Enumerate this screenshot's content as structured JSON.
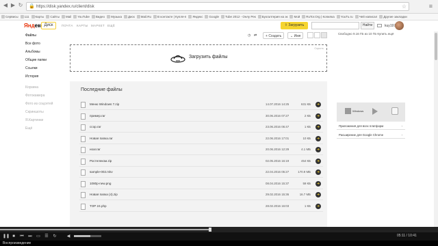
{
  "browser": {
    "url": "https://disk.yandex.ru/client/disk",
    "bookmarks": [
      "Сервисы",
      "111",
      "Карты",
      "Сайты",
      "Mail",
      "YouTube",
      "Видео",
      "Музыка",
      "Диск",
      "Mail.Ru",
      "В контакте | Купля-п",
      "Яндекс",
      "Google",
      "Tube 2012 - Онлу Рек",
      "Бухгалтерия на эк",
      "Мой",
      "RuTor.Org | Копилка",
      "YouTu.ru",
      "Чей написал",
      "Другие закладки"
    ]
  },
  "header": {
    "logo_main": "Янд",
    "logo_accent": "екс",
    "disk_label": "Диск",
    "nav": [
      "ПОЧТА",
      "КАРТЫ",
      "МАРКЕТ",
      "ЕЩЁ"
    ],
    "upload_label": "Загрузить",
    "search_placeholder": "",
    "find_label": "Найти",
    "username": "kuy1975"
  },
  "sidebar": {
    "items": [
      "Файлы",
      "Все фото",
      "Альбомы",
      "Общие папки",
      "Ссылки",
      "История"
    ],
    "extra": [
      "Корзина",
      "Фотокамера",
      "Фото из соцсетей",
      "Скриншоты",
      "Я.Картинки",
      "Ещё"
    ]
  },
  "toolbar": {
    "create_label": "Создать",
    "sort_label": "Имя"
  },
  "dropzone": {
    "label": "Загрузить файлы",
    "hint": "Скрыть"
  },
  "recent": {
    "title": "Последние файлы",
    "files": [
      {
        "name": "Меню Windows 7.zip",
        "date": "14.07.2016 14:25",
        "size": "631 КБ"
      },
      {
        "name": "пример.rar",
        "date": "30.06.2016 07:27",
        "size": "2 КБ"
      },
      {
        "name": "ccop.rar",
        "date": "23.06.2016 06:47",
        "size": "1 КБ"
      },
      {
        "name": "Новая папка.rar",
        "date": "22.06.2016 17:01",
        "size": "10 КБ"
      },
      {
        "name": "ноаг.rar",
        "date": "20.06.2016 12:29",
        "size": "4.1 МБ"
      },
      {
        "name": "Ростелеком.zip",
        "date": "02.05.2016 16:19",
        "size": "454 КБ"
      },
      {
        "name": "sample-002.mkv",
        "date": "22.04.2016 05:27",
        "size": "170.9 МБ"
      },
      {
        "name": "1080p-new.png",
        "date": "08.04.2016 15:37",
        "size": "59 КБ"
      },
      {
        "name": "Новая папка (4).zip",
        "date": "29.02.2016 15:36",
        "size": "16.7 МБ"
      },
      {
        "name": "TOP 24.php",
        "date": "28.02.2016 16:03",
        "size": "1 КБ"
      }
    ]
  },
  "right_panel": {
    "space": "Свободно 9.16 ГБ из 10 ГБ",
    "buy": "Купить ещё",
    "promo_windows": "Windows",
    "links": [
      "Приложения для всех платформ",
      "Расширение для Google Chrome"
    ]
  },
  "player": {
    "progress": 0.48,
    "volume": 0.6,
    "time": "05:11 / 10:41",
    "status": "Воспроизведение"
  }
}
